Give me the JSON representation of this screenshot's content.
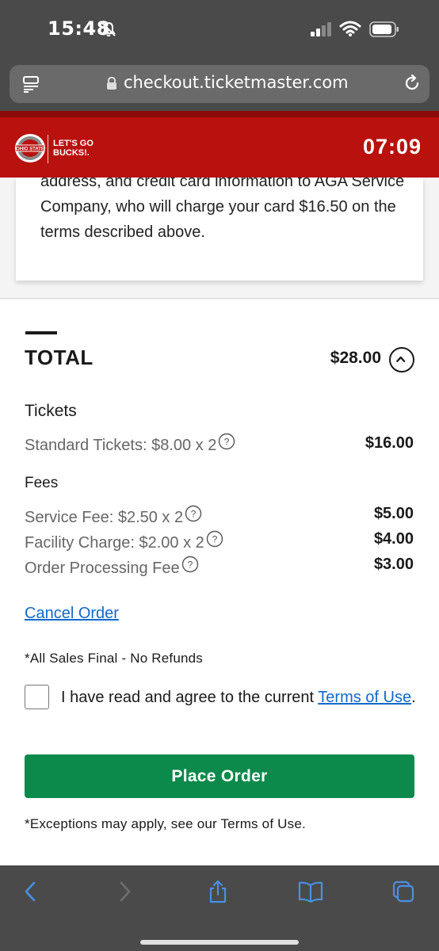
{
  "status_bar": {
    "time": "15:48"
  },
  "browser": {
    "url": "checkout.ticketmaster.com"
  },
  "brand": {
    "tagline": "LET'S GO BUCKS!.",
    "timer": "07:09",
    "colors": {
      "primary": "#b8110e",
      "button_green": "#0b8a4b",
      "link_blue": "#0f6acb"
    }
  },
  "terms_card": {
    "text": "address, and credit card information to AGA Service Company, who will charge your card $16.50 on the terms described above."
  },
  "total": {
    "label": "TOTAL",
    "value": "$28.00"
  },
  "tickets": {
    "heading": "Tickets",
    "items": [
      {
        "label": "Standard Tickets: $8.00 x 2",
        "value": "$16.00"
      }
    ]
  },
  "fees": {
    "heading": "Fees",
    "items": [
      {
        "label": "Service Fee: $2.50 x 2",
        "value": "$5.00"
      },
      {
        "label": "Facility Charge: $2.00 x 2",
        "value": "$4.00"
      },
      {
        "label": "Order Processing Fee",
        "value": "$3.00"
      }
    ]
  },
  "actions": {
    "cancel_order": "Cancel Order",
    "sales_final": "*All Sales Final - No Refunds",
    "agree_prefix": "I have read and agree to the current ",
    "terms_link": "Terms of Use",
    "agree_suffix": ".",
    "place_order": "Place Order",
    "exceptions": "*Exceptions may apply, see our Terms of Use."
  },
  "icons": [
    "bell-slash-icon",
    "signal-icon",
    "wifi-icon",
    "battery-icon",
    "reader-icon",
    "lock-icon",
    "reload-icon",
    "chevron-up-icon",
    "help-icon",
    "back-icon",
    "forward-icon",
    "share-icon",
    "bookmarks-icon",
    "tabs-icon"
  ]
}
